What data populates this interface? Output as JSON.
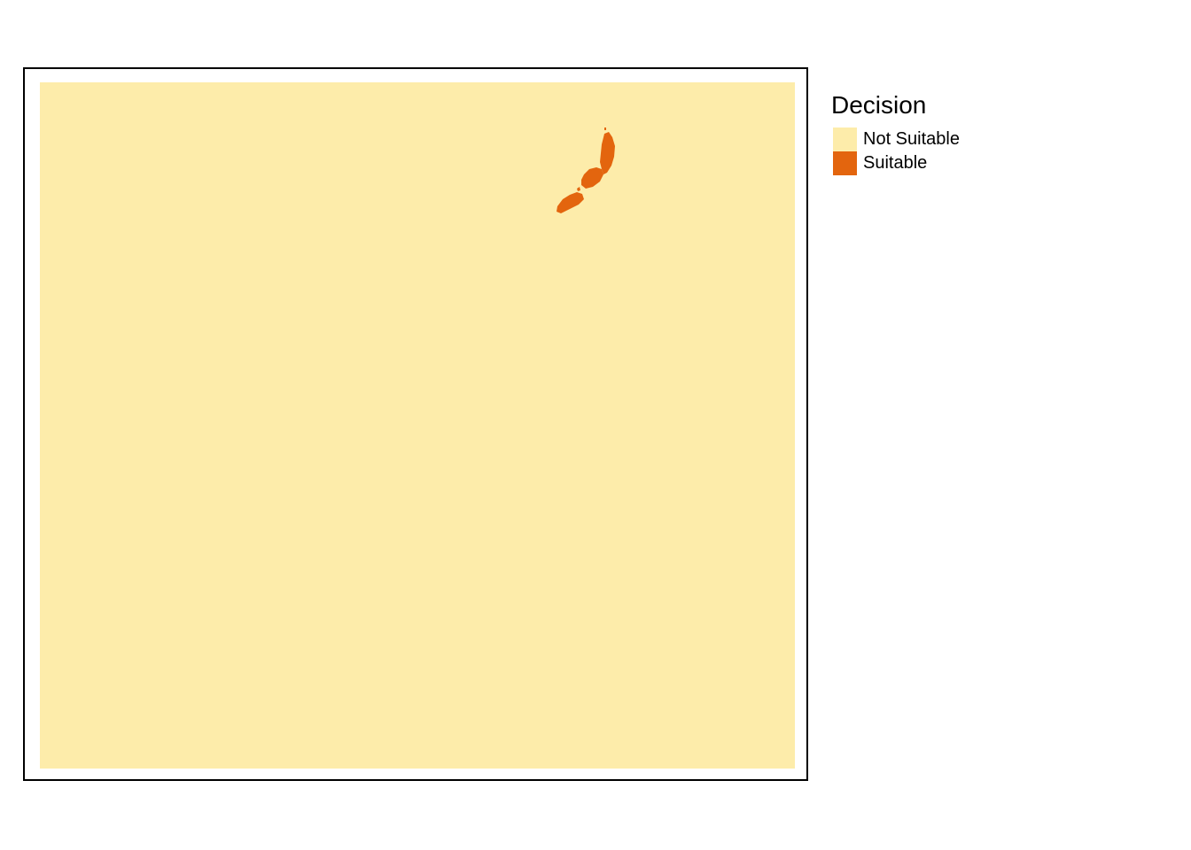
{
  "map": {
    "fill_colors": {
      "not_suitable": "#FDECAA",
      "suitable": "#E3650E"
    }
  },
  "legend": {
    "title": "Decision",
    "items": [
      {
        "label": "Not Suitable",
        "color": "#FDECAA"
      },
      {
        "label": "Suitable",
        "color": "#E3650E"
      }
    ]
  }
}
